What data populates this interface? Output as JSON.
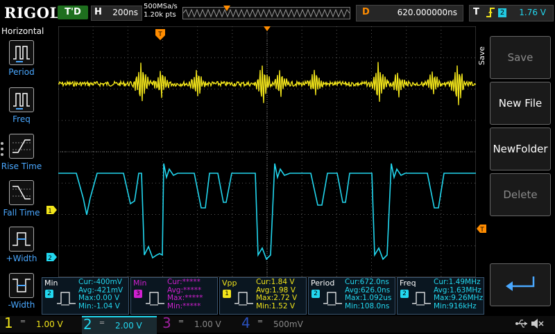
{
  "header": {
    "brand": "RIGOL",
    "run_state": "T'D",
    "timebase_key": "H",
    "timebase": "200ns",
    "sample_rate": "500MSa/s",
    "memory_depth": "1.20k pts",
    "delay_key": "D",
    "delay": "620.000000ns",
    "trigger_key": "T",
    "trigger_source": "2",
    "trigger_level": "1.76 V"
  },
  "left_panel": {
    "title": "Horizontal",
    "items": [
      {
        "label": "Period"
      },
      {
        "label": "Freq"
      },
      {
        "label": "Rise Time"
      },
      {
        "label": "Fall Time"
      },
      {
        "label": "+Width"
      },
      {
        "label": "-Width"
      }
    ]
  },
  "right_panel": {
    "title": "Save",
    "buttons": [
      {
        "label": "Save",
        "enabled": false
      },
      {
        "label": "New File",
        "enabled": true
      },
      {
        "label": "NewFolder",
        "enabled": true
      },
      {
        "label": "Delete",
        "enabled": false
      }
    ]
  },
  "markers": {
    "ch1": "1",
    "ch2": "2",
    "trigger": "T"
  },
  "measurements": [
    {
      "name": "Min",
      "channel": "2",
      "channel_color": "#22d8f0",
      "name_color": "#ffffff",
      "cur": "Cur:-400mV",
      "avg": "Avg:-421mV",
      "max": "Max:0.00 V",
      "min": "Min:-1.04 V"
    },
    {
      "name": "Min",
      "channel": "3",
      "channel_color": "#d020d0",
      "name_color": "#d020d0",
      "cur": "Cur:*****",
      "avg": "Avg:*****",
      "max": "Max:*****",
      "min": "Min:*****"
    },
    {
      "name": "Vpp",
      "channel": "1",
      "channel_color": "#f2e51a",
      "name_color": "#f2e51a",
      "cur": "Cur:1.84 V",
      "avg": "Avg:1.98 V",
      "max": "Max:2.72 V",
      "min": "Min:1.52 V"
    },
    {
      "name": "Period",
      "channel": "2",
      "channel_color": "#22d8f0",
      "name_color": "#ffffff",
      "cur": "Cur:672.0ns",
      "avg": "Avg:626.0ns",
      "max": "Max:1.092us",
      "min": "Min:108.0ns"
    },
    {
      "name": "Freq",
      "channel": "2",
      "channel_color": "#22d8f0",
      "name_color": "#ffffff",
      "cur": "Cur:1.49MHz",
      "avg": "Avg:1.63MHz",
      "max": "Max:9.26MHz",
      "min": "Min:916kHz"
    }
  ],
  "channels": [
    {
      "num": "1",
      "coupling": "DC",
      "scale": "1.00 V",
      "color": "#f2e51a",
      "active": true
    },
    {
      "num": "2",
      "coupling": "DC",
      "scale": "2.00 V",
      "color": "#22d8f0",
      "active": true
    },
    {
      "num": "3",
      "coupling": "DC",
      "scale": "1.00 V",
      "color": "#a020a0",
      "active": false
    },
    {
      "num": "4",
      "coupling": "DC",
      "scale": "500mV",
      "color": "#2a52c0",
      "active": false
    }
  ],
  "colors": {
    "ch1": "#f2e51a",
    "ch2": "#22d8f0",
    "trigger": "#ff8c00",
    "grid": "#5a5a5a"
  },
  "icons": [
    "usb-icon",
    "speaker-muted-icon",
    "return-arrow-icon"
  ]
}
